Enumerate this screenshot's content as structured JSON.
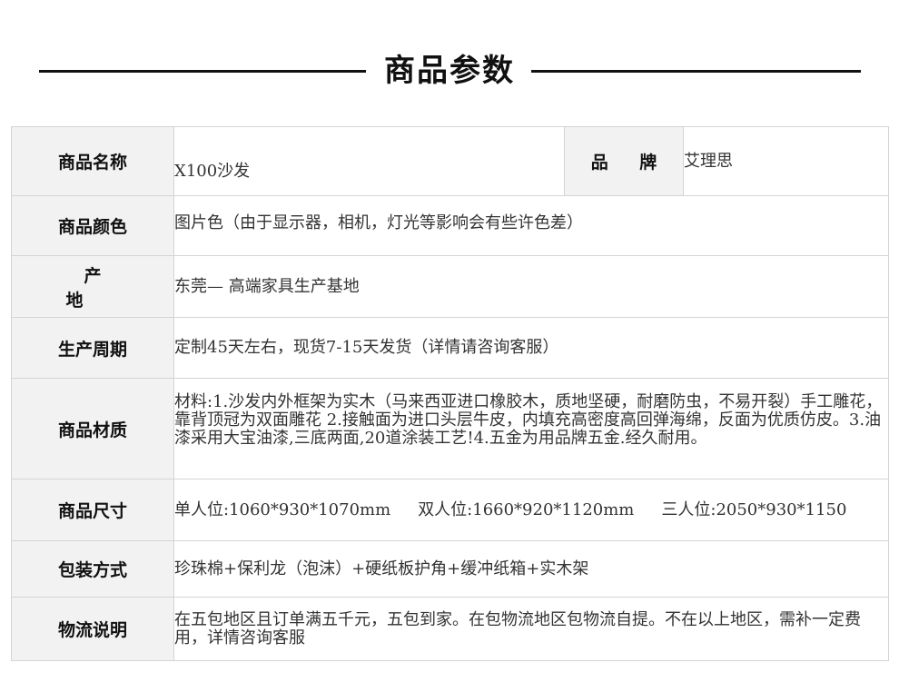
{
  "header": {
    "title": "商品参数"
  },
  "params": {
    "name_label": "商品名称",
    "name_value": "X100沙发",
    "brand_label": "品 牌",
    "brand_value": "艾理思",
    "color_label": "商品颜色",
    "color_value": "图片色（由于显示器，相机，灯光等影响会有些许色差）",
    "origin_label": "产 地",
    "origin_value": "东莞— 高端家具生产基地",
    "cycle_label": "生产周期",
    "cycle_value": "定制45天左右，现货7-15天发货（详情请咨询客服）",
    "material_label": "商品材质",
    "material_value": "材料:1.沙发内外框架为实木（马来西亚进口橡胶木，质地坚硬，耐磨防虫，不易开裂）手工雕花，靠背顶冠为双面雕花 2.接触面为进口头层牛皮，内填充高密度高回弹海绵，反面为优质仿皮。3.油漆采用大宝油漆,三底两面,20道涂装工艺!4.五金为用品牌五金.经久耐用。",
    "size_label": "商品尺寸",
    "size_single": "单人位:1060*930*1070mm",
    "size_double": "双人位:1660*920*1120mm",
    "size_triple": "三人位:2050*930*1150",
    "package_label": "包装方式",
    "package_value": "珍珠棉+保利龙（泡沫）+硬纸板护角+缓冲纸箱+实木架",
    "logistics_label": "物流说明",
    "logistics_value": "在五包地区且订单满五千元，五包到家。在包物流地区包物流自提。不在以上地区，需补一定费用，详情咨询客服"
  }
}
